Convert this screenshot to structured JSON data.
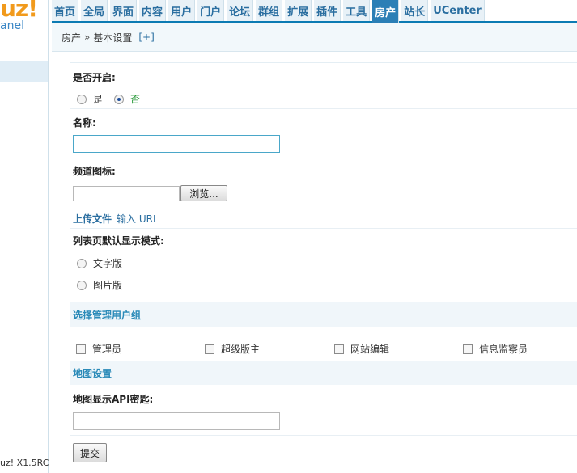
{
  "brand": {
    "logo": "uz!",
    "subtitle": "anel",
    "version": "uz! X1.5RC"
  },
  "nav": [
    "首页",
    "全局",
    "界面",
    "内容",
    "用户",
    "门户",
    "论坛",
    "群组",
    "扩展",
    "插件",
    "工具",
    "房产",
    "站长",
    "UCenter"
  ],
  "nav_active": "房产",
  "breadcrumb": {
    "parent": "房产",
    "separator": "»",
    "current": "基本设置",
    "toggle": "[+]"
  },
  "form": {
    "enabled": {
      "label": "是否开启:",
      "yes": "是",
      "no": "否",
      "selected": "no"
    },
    "name": {
      "label": "名称:",
      "value": ""
    },
    "icon": {
      "label": "频道图标:",
      "browse": "浏览...",
      "upload": "上传文件",
      "url": "输入 URL"
    },
    "list_mode": {
      "label": "列表页默认显示模式:",
      "options": [
        "文字版",
        "图片版"
      ]
    },
    "groups": {
      "section": "选择管理用户组",
      "items": [
        "管理员",
        "超级版主",
        "网站编辑",
        "信息监察员"
      ]
    },
    "map": {
      "section": "地图设置",
      "label": "地图显示API密匙:",
      "value": ""
    },
    "submit": "提交"
  },
  "colors": {
    "accent": "#0c7bb3",
    "nav_active_bg": "#2b7fb6",
    "section_text": "#2a8ab8",
    "option_selected": "#2a9a3a"
  }
}
